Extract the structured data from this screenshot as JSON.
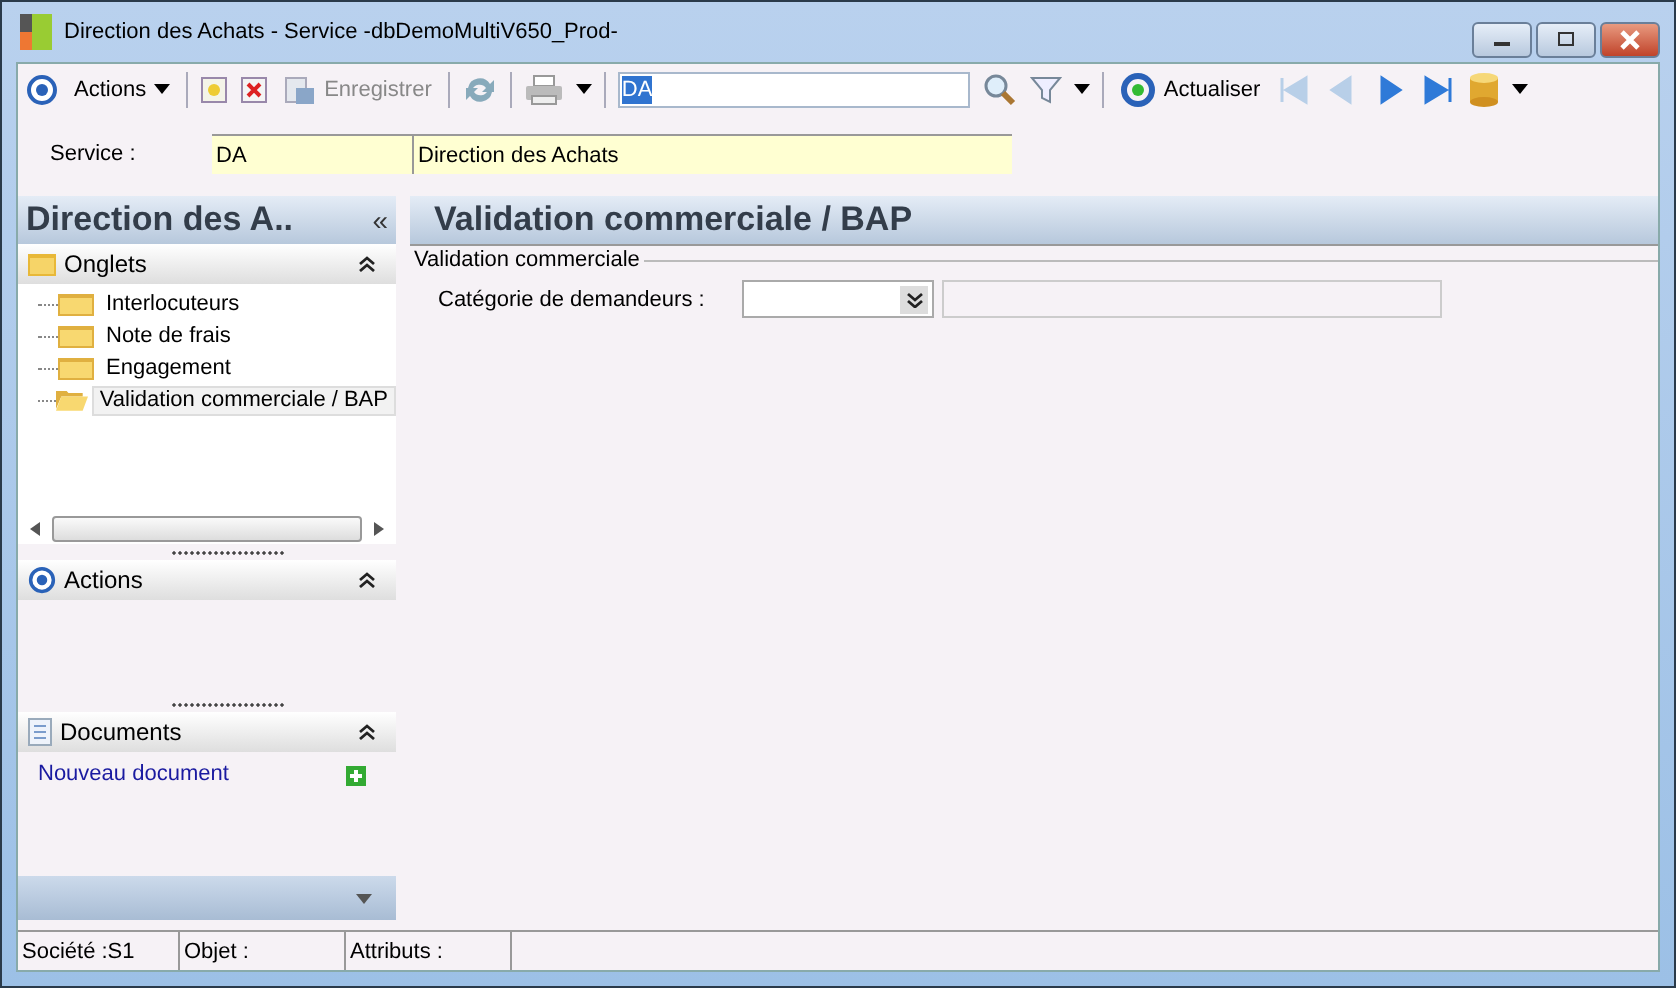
{
  "window": {
    "title": "Direction des Achats -  Service -dbDemoMultiV650_Prod-"
  },
  "toolbar": {
    "actions_label": "Actions",
    "save": {
      "label": "Enregistrer",
      "disabled": true
    },
    "search_value": "DA",
    "refresh_label": "Actualiser",
    "nav": [
      {
        "kind": "first",
        "disabled": true
      },
      {
        "kind": "prev",
        "disabled": true
      },
      {
        "kind": "next",
        "disabled": false
      },
      {
        "kind": "last",
        "disabled": false
      }
    ]
  },
  "service": {
    "label": "Service :",
    "code": "DA",
    "name": "Direction des Achats"
  },
  "sidebar": {
    "title": "Direction des A..",
    "collapse_glyph": "«",
    "tabs_panel": {
      "title": "Onglets",
      "items": [
        {
          "label": "Interlocuteurs",
          "selected": false
        },
        {
          "label": "Note de frais",
          "selected": false
        },
        {
          "label": "Engagement",
          "selected": false
        },
        {
          "label": "Validation commerciale / BAP",
          "selected": true
        }
      ]
    },
    "actions_panel": {
      "title": "Actions"
    },
    "documents_panel": {
      "title": "Documents",
      "link": "Nouveau document"
    }
  },
  "content": {
    "title": "Validation commerciale / BAP",
    "group": "Validation commerciale",
    "field_label": "Catégorie de demandeurs :"
  },
  "status_bar": [
    "Société :S1",
    "Objet :",
    "Attributs :"
  ]
}
